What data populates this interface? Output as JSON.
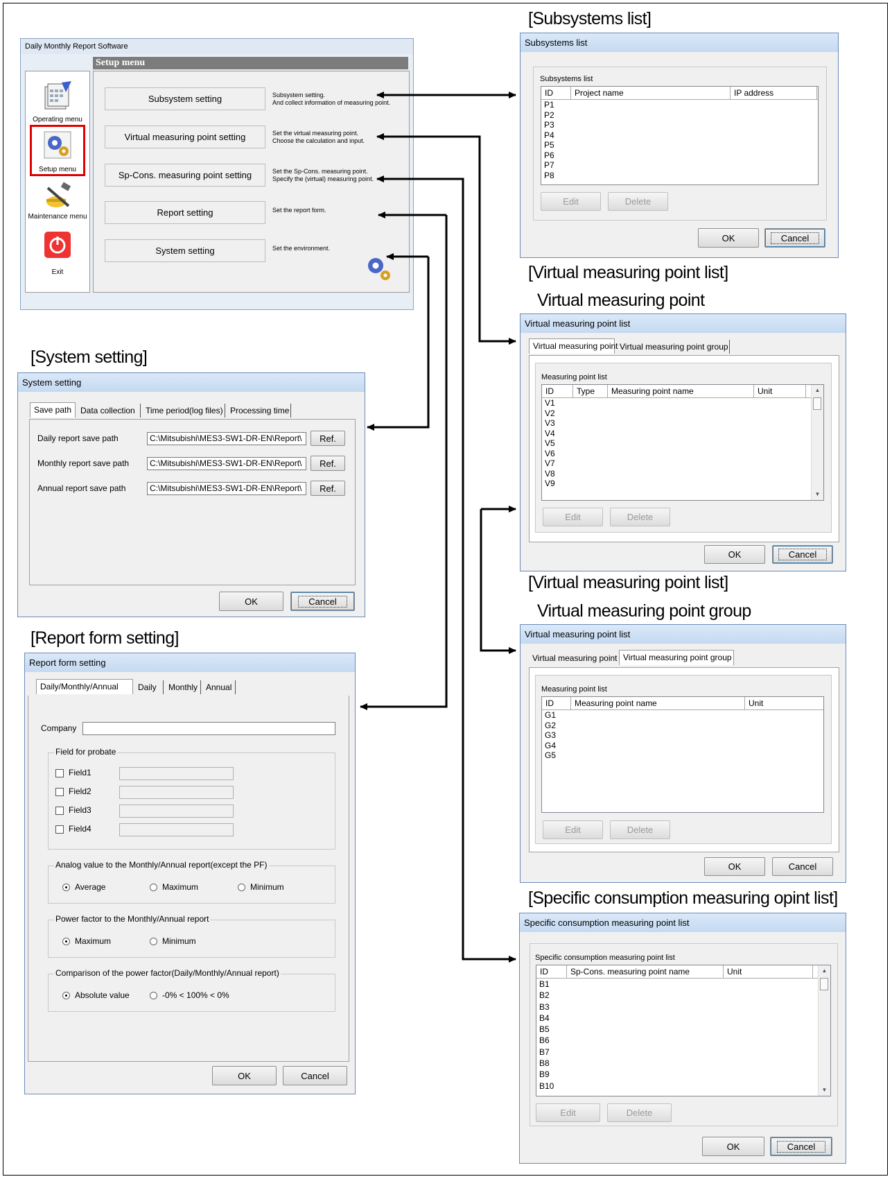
{
  "headings": {
    "subsystems": "[Subsystems list]",
    "virtual_list_1_line1": "[Virtual measuring point list]",
    "virtual_list_1_line2": "Virtual measuring point",
    "system_setting": "[System setting]",
    "virtual_list_2_line1": "[Virtual measuring point list]",
    "virtual_list_2_line2": "Virtual measuring point group",
    "report_form": "[Report form setting]",
    "spcons": "[Specific consumption measuring opint list]"
  },
  "main_window": {
    "title": "Daily Monthly Report Software",
    "section_title": "Setup menu",
    "sidebar": [
      {
        "label": "Operating menu",
        "icon": "calendar-icon"
      },
      {
        "label": "Setup menu",
        "icon": "gears-icon"
      },
      {
        "label": "Maintenance menu",
        "icon": "tools-icon"
      },
      {
        "label": "Exit",
        "icon": "power-icon"
      }
    ],
    "items": [
      {
        "label": "Subsystem setting",
        "desc1": "Subsystem setting.",
        "desc2": "And collect information of measuring point."
      },
      {
        "label": "Virtual measuring point setting",
        "desc1": "Set the virtual measuring point.",
        "desc2": "Choose the calculation and input."
      },
      {
        "label": "Sp-Cons. measuring point setting",
        "desc1": "Set the Sp-Cons. measuring point.",
        "desc2": "Specify the (virtual) measuring point."
      },
      {
        "label": "Report setting",
        "desc1": "Set the report form.",
        "desc2": ""
      },
      {
        "label": "System setting",
        "desc1": "Set the environment.",
        "desc2": ""
      }
    ]
  },
  "subsystems": {
    "title": "Subsystems list",
    "group": "Subsystems list",
    "columns": [
      "ID",
      "Project name",
      "IP address"
    ],
    "rows": [
      "P1",
      "P2",
      "P3",
      "P4",
      "P5",
      "P6",
      "P7",
      "P8"
    ],
    "edit": "Edit",
    "delete": "Delete",
    "ok": "OK",
    "cancel": "Cancel"
  },
  "virtual1": {
    "title": "Virtual measuring point list",
    "tabs": [
      "Virtual measuring point",
      "Virtual measuring point group"
    ],
    "group": "Measuring point list",
    "columns": [
      "ID",
      "Type",
      "Measuring point name",
      "Unit"
    ],
    "rows": [
      "V1",
      "V2",
      "V3",
      "V4",
      "V5",
      "V6",
      "V7",
      "V8",
      "V9"
    ],
    "edit": "Edit",
    "delete": "Delete",
    "ok": "OK",
    "cancel": "Cancel"
  },
  "virtual2": {
    "title": "Virtual measuring point list",
    "tabs": [
      "Virtual measuring point",
      "Virtual measuring point group"
    ],
    "group": "Measuring point list",
    "columns": [
      "ID",
      "Measuring point name",
      "Unit"
    ],
    "rows": [
      "G1",
      "G2",
      "G3",
      "G4",
      "G5"
    ],
    "edit": "Edit",
    "delete": "Delete",
    "ok": "OK",
    "cancel": "Cancel"
  },
  "spcons": {
    "title": "Specific consumption measuring point list",
    "group": "Specific consumption measuring point list",
    "columns": [
      "ID",
      "Sp-Cons. measuring point name",
      "Unit"
    ],
    "rows": [
      "B1",
      "B2",
      "B3",
      "B4",
      "B5",
      "B6",
      "B7",
      "B8",
      "B9",
      "B10"
    ],
    "edit": "Edit",
    "delete": "Delete",
    "ok": "OK",
    "cancel": "Cancel"
  },
  "system_setting": {
    "title": "System setting",
    "tabs": [
      "Save path",
      "Data collection",
      "Time period(log files)",
      "Processing time"
    ],
    "rows": [
      {
        "label": "Daily report save path",
        "value": "C:\\Mitsubishi\\MES3-SW1-DR-EN\\Report\\",
        "ref": "Ref."
      },
      {
        "label": "Monthly report save path",
        "value": "C:\\Mitsubishi\\MES3-SW1-DR-EN\\Report\\",
        "ref": "Ref."
      },
      {
        "label": "Annual report save path",
        "value": "C:\\Mitsubishi\\MES3-SW1-DR-EN\\Report\\",
        "ref": "Ref."
      }
    ],
    "ok": "OK",
    "cancel": "Cancel"
  },
  "report_form": {
    "title": "Report form setting",
    "tabs": [
      "Daily/Monthly/Annual",
      "Daily",
      "Monthly",
      "Annual"
    ],
    "company_label": "Company",
    "company_value": "",
    "probate_group": "Field for probate",
    "fields": [
      "Field1",
      "Field2",
      "Field3",
      "Field4"
    ],
    "analog_group": "Analog value to the Monthly/Annual report(except the PF)",
    "analog_options": [
      "Average",
      "Maximum",
      "Minimum"
    ],
    "pf_group": "Power factor to the Monthly/Annual report",
    "pf_options": [
      "Maximum",
      "Minimum"
    ],
    "cmp_group": "Comparison of the power factor(Daily/Monthly/Annual report)",
    "cmp_options": [
      "Absolute value",
      "-0% < 100% < 0%"
    ],
    "ok": "OK",
    "cancel": "Cancel"
  }
}
